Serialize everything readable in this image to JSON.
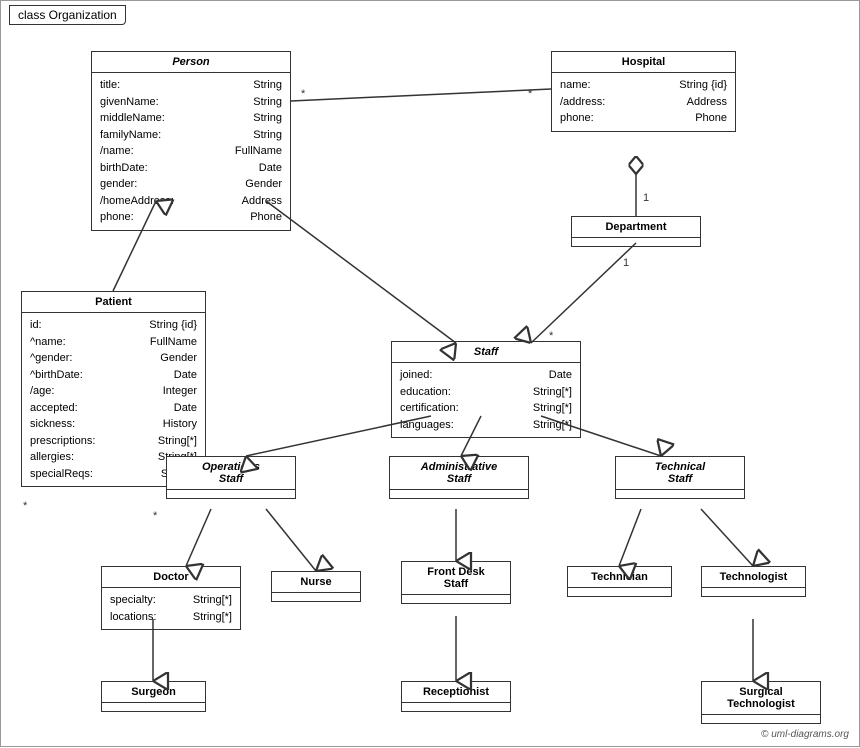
{
  "title": "class Organization",
  "classes": {
    "person": {
      "name": "Person",
      "italic": true,
      "attrs": [
        [
          "title:",
          "String"
        ],
        [
          "givenName:",
          "String"
        ],
        [
          "middleName:",
          "String"
        ],
        [
          "familyName:",
          "String"
        ],
        [
          "/name:",
          "FullName"
        ],
        [
          "birthDate:",
          "Date"
        ],
        [
          "gender:",
          "Gender"
        ],
        [
          "/homeAddress:",
          "Address"
        ],
        [
          "phone:",
          "Phone"
        ]
      ]
    },
    "hospital": {
      "name": "Hospital",
      "italic": false,
      "attrs": [
        [
          "name:",
          "String {id}"
        ],
        [
          "/address:",
          "Address"
        ],
        [
          "phone:",
          "Phone"
        ]
      ]
    },
    "patient": {
      "name": "Patient",
      "italic": false,
      "attrs": [
        [
          "id:",
          "String {id}"
        ],
        [
          "^name:",
          "FullName"
        ],
        [
          "^gender:",
          "Gender"
        ],
        [
          "^birthDate:",
          "Date"
        ],
        [
          "/age:",
          "Integer"
        ],
        [
          "accepted:",
          "Date"
        ],
        [
          "sickness:",
          "History"
        ],
        [
          "prescriptions:",
          "String[*]"
        ],
        [
          "allergies:",
          "String[*]"
        ],
        [
          "specialReqs:",
          "Sring[*]"
        ]
      ]
    },
    "department": {
      "name": "Department",
      "italic": false,
      "attrs": []
    },
    "staff": {
      "name": "Staff",
      "italic": true,
      "attrs": [
        [
          "joined:",
          "Date"
        ],
        [
          "education:",
          "String[*]"
        ],
        [
          "certification:",
          "String[*]"
        ],
        [
          "languages:",
          "String[*]"
        ]
      ]
    },
    "operations_staff": {
      "name": "Operations Staff",
      "italic": true,
      "attrs": []
    },
    "administrative_staff": {
      "name": "Administrative Staff",
      "italic": true,
      "attrs": []
    },
    "technical_staff": {
      "name": "Technical Staff",
      "italic": true,
      "attrs": []
    },
    "doctor": {
      "name": "Doctor",
      "italic": false,
      "attrs": [
        [
          "specialty:",
          "String[*]"
        ],
        [
          "locations:",
          "String[*]"
        ]
      ]
    },
    "nurse": {
      "name": "Nurse",
      "italic": false,
      "attrs": []
    },
    "front_desk_staff": {
      "name": "Front Desk Staff",
      "italic": false,
      "attrs": []
    },
    "technician": {
      "name": "Technician",
      "italic": false,
      "attrs": []
    },
    "technologist": {
      "name": "Technologist",
      "italic": false,
      "attrs": []
    },
    "surgeon": {
      "name": "Surgeon",
      "italic": false,
      "attrs": []
    },
    "receptionist": {
      "name": "Receptionist",
      "italic": false,
      "attrs": []
    },
    "surgical_technologist": {
      "name": "Surgical Technologist",
      "italic": false,
      "attrs": []
    }
  },
  "copyright": "© uml-diagrams.org"
}
